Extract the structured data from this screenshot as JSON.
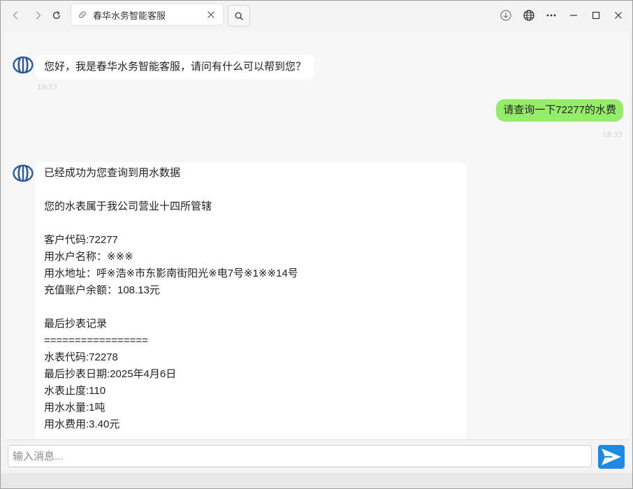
{
  "browser": {
    "tab_title": "春华水务智能客服",
    "icons": [
      "back-icon",
      "forward-icon",
      "refresh-icon",
      "link-icon",
      "close-icon",
      "search-icon",
      "download-icon",
      "globe-icon",
      "more-icon",
      "minimize-icon",
      "maximize-icon",
      "window-close-icon"
    ]
  },
  "chat": {
    "messages": [
      {
        "role": "bot",
        "text": "您好，我是春华水务智能客服，请问有什么可以帮到您？",
        "time": "18:33"
      },
      {
        "role": "user",
        "text": "请查询一下72277的水费",
        "time": "18:33"
      },
      {
        "role": "bot",
        "text": "已经成功为您查询到用水数据\n\n您的水表属于我公司营业十四所管辖\n\n客户代码:72277\n用水户名称：※※※\n用水地址：呼※浩※市东影南街阳光※电7号※1※※14号\n充值账户余额：108.13元\n\n最后抄表记录\n=================\n水表代码:72278\n最后抄表日期:2025年4月6日\n水表止度:110\n用水水量:1吨\n用水费用:3.40元"
      }
    ]
  },
  "input": {
    "placeholder": "输入消息...",
    "value": ""
  },
  "colors": {
    "user_bubble": "#95ec69",
    "bot_bubble": "#ffffff",
    "send_button": "#1e88e5",
    "avatar": "#2a5a9a"
  }
}
